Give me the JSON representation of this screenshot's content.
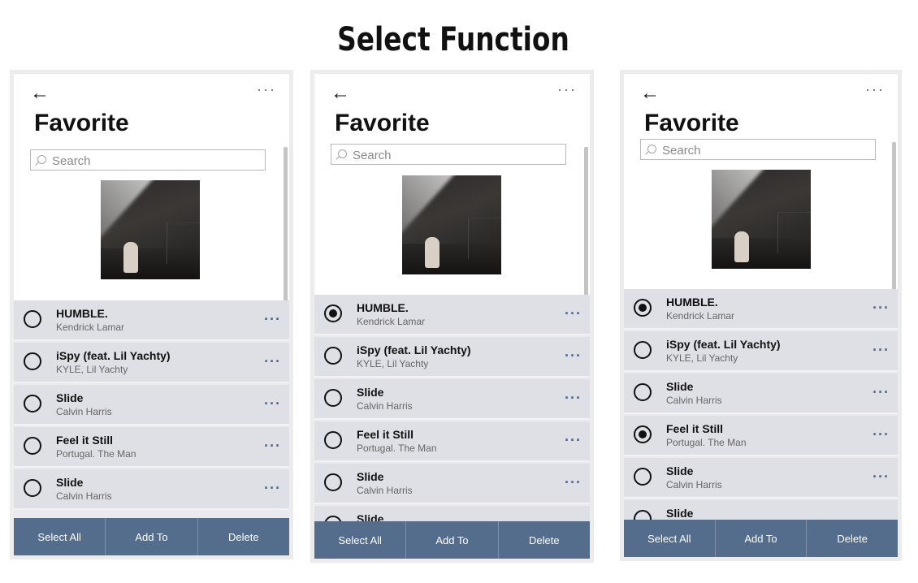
{
  "page": {
    "title": "Select Function"
  },
  "icons": {
    "back": "back-arrow-icon",
    "more": "more-dots-icon",
    "search": "search-icon",
    "radio": "radio-icon"
  },
  "colors": {
    "accent": "#546d8c",
    "list_bg": "#dfdfe6",
    "dots": "#4d6a8f"
  },
  "screens": [
    {
      "back_glyph": "←",
      "more_glyph": "···",
      "title": "Favorite",
      "search_placeholder": "Search",
      "rows": [
        {
          "title": "HUMBLE.",
          "artist": "Kendrick Lamar",
          "selected": false
        },
        {
          "title": "iSpy (feat. Lil Yachty)",
          "artist": "KYLE, Lil Yachty",
          "selected": false
        },
        {
          "title": "Slide",
          "artist": "Calvin Harris",
          "selected": false
        },
        {
          "title": "Feel it Still",
          "artist": "Portugal. The Man",
          "selected": false
        },
        {
          "title": "Slide",
          "artist": "Calvin Harris",
          "selected": false
        }
      ],
      "bottom": {
        "select_all": "Select All",
        "add_to": "Add To",
        "delete": "Delete"
      }
    },
    {
      "back_glyph": "←",
      "more_glyph": "···",
      "title": "Favorite",
      "search_placeholder": "Search",
      "rows": [
        {
          "title": "HUMBLE.",
          "artist": "Kendrick Lamar",
          "selected": true
        },
        {
          "title": "iSpy (feat. Lil Yachty)",
          "artist": "KYLE, Lil Yachty",
          "selected": false
        },
        {
          "title": "Slide",
          "artist": "Calvin Harris",
          "selected": false
        },
        {
          "title": "Feel it Still",
          "artist": "Portugal. The Man",
          "selected": false
        },
        {
          "title": "Slide",
          "artist": "Calvin Harris",
          "selected": false
        },
        {
          "title": "Slide",
          "artist": "",
          "selected": false
        }
      ],
      "bottom": {
        "select_all": "Select All",
        "add_to": "Add To",
        "delete": "Delete"
      }
    },
    {
      "back_glyph": "←",
      "more_glyph": "···",
      "title": "Favorite",
      "search_placeholder": "Search",
      "rows": [
        {
          "title": "HUMBLE.",
          "artist": "Kendrick Lamar",
          "selected": true
        },
        {
          "title": "iSpy (feat. Lil Yachty)",
          "artist": "KYLE, Lil Yachty",
          "selected": false
        },
        {
          "title": "Slide",
          "artist": "Calvin Harris",
          "selected": false
        },
        {
          "title": "Feel it Still",
          "artist": "Portugal. The Man",
          "selected": true
        },
        {
          "title": "Slide",
          "artist": "Calvin Harris",
          "selected": false
        },
        {
          "title": "Slide",
          "artist": "",
          "selected": false
        }
      ],
      "bottom": {
        "select_all": "Select All",
        "add_to": "Add To",
        "delete": "Delete"
      }
    }
  ]
}
